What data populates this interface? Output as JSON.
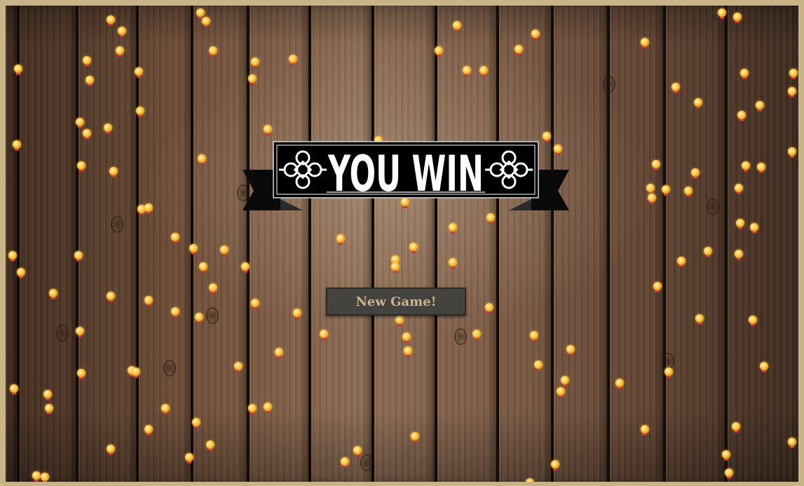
{
  "banner": {
    "text": "YOU WIN"
  },
  "new_game_button": {
    "label": "New Game!"
  },
  "colors": {
    "frame": "#c9b48a",
    "banner": "#000000",
    "banner_text": "#ffffff",
    "button_bg": "#444340",
    "button_text": "#cbb58a",
    "coin": "#f2a51e",
    "coin_ribbon": "#c0302a"
  },
  "icons": [
    "celtic-knot-icon",
    "coin-medal-icon"
  ]
}
